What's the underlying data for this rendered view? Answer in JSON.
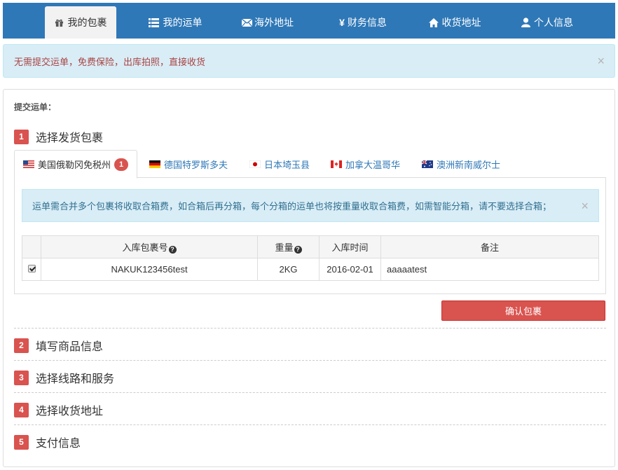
{
  "nav": {
    "items": [
      {
        "label": "我的包裹",
        "icon": "gift-icon",
        "active": true
      },
      {
        "label": "我的运单",
        "icon": "list-icon"
      },
      {
        "label": "海外地址",
        "icon": "envelope-icon"
      },
      {
        "label": "财务信息",
        "icon": "yen-icon"
      },
      {
        "label": "收货地址",
        "icon": "home-icon"
      },
      {
        "label": "个人信息",
        "icon": "user-icon"
      }
    ]
  },
  "top_alert": {
    "text": "无需提交运单，免费保险，出库拍照，直接收货",
    "close": "×"
  },
  "panel": {
    "title": "提交运单：",
    "steps": [
      {
        "num": "1",
        "label": "选择发货包裹"
      },
      {
        "num": "2",
        "label": "填写商品信息"
      },
      {
        "num": "3",
        "label": "选择线路和服务"
      },
      {
        "num": "4",
        "label": "选择收货地址"
      },
      {
        "num": "5",
        "label": "支付信息"
      }
    ],
    "tabs": [
      {
        "label": "美国俄勒冈免税州",
        "flag": "us-flag-icon",
        "count": "1"
      },
      {
        "label": "德国特罗斯多夫",
        "flag": "de-flag-icon"
      },
      {
        "label": "日本埼玉县",
        "flag": "jp-flag-icon"
      },
      {
        "label": "加拿大温哥华",
        "flag": "ca-flag-icon"
      },
      {
        "label": "澳洲新南威尔士",
        "flag": "au-flag-icon"
      }
    ],
    "info": {
      "text": "运单需合并多个包裹将收取合箱费，如合箱后再分箱，每个分箱的运单也将按重量收取合箱费，如需智能分箱，请不要选择合箱；",
      "close": "×"
    },
    "table": {
      "headers": [
        "入库包裹号",
        "重量",
        "入库时间",
        "备注"
      ],
      "help_mark": "?",
      "rows": [
        {
          "checked": true,
          "id": "NAKUK123456test",
          "weight": "2KG",
          "date": "2016-02-01",
          "note": "aaaaatest"
        }
      ]
    },
    "confirm_label": "确认包裹"
  }
}
